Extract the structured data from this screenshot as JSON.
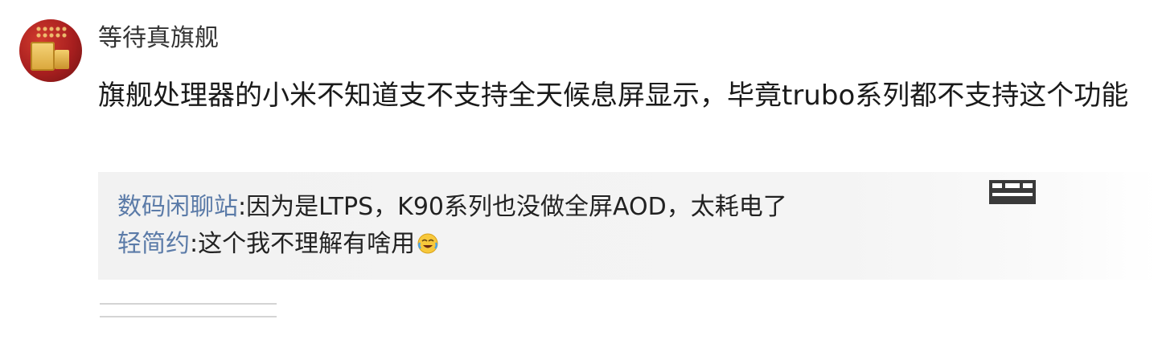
{
  "comment": {
    "username": "等待真旗舰",
    "text": "旗舰处理器的小米不知道支不支持全天候息屏显示，毕竟trubo系列都不支持这个功能"
  },
  "replies": [
    {
      "name": "数码闲聊站",
      "separator": ":",
      "text": "因为是LTPS，K90系列也没做全屏AOD，太耗电了"
    },
    {
      "name": "轻简约",
      "separator": ":",
      "text": "这个我不理解有啥用",
      "emoji": "laughing-crying-emoji"
    }
  ],
  "colors": {
    "reply_name": "#5b7ba8",
    "reply_bg": "#f2f2f2",
    "text": "#1a1a1a"
  }
}
